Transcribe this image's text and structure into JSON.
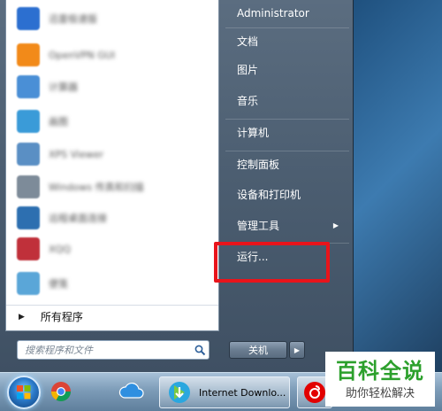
{
  "start_menu": {
    "all_programs_label": "所有程序",
    "search_placeholder": "搜索程序和文件",
    "right_items": [
      {
        "label": "Administrator"
      },
      {
        "label": "文档"
      },
      {
        "label": "图片"
      },
      {
        "label": "音乐"
      },
      {
        "label": "计算机"
      },
      {
        "label": "控制面板"
      },
      {
        "label": "设备和打印机"
      },
      {
        "label": "管理工具"
      },
      {
        "label": "运行..."
      }
    ],
    "shutdown_label": "关机",
    "highlight_color": "#e8141b",
    "pinned_programs": [
      {
        "label": "迅雷极速版",
        "icon": "app-icon",
        "color": "#2c6fd0"
      },
      {
        "label": "OpenVPN GUI",
        "icon": "openvpn-icon",
        "color": "#f28a19"
      },
      {
        "label": "计算器",
        "icon": "calculator-icon",
        "color": "#4a8fd6"
      },
      {
        "label": "画图",
        "icon": "paint-icon",
        "color": "#3a9bd8"
      },
      {
        "label": "XPS Viewer",
        "icon": "xps-icon",
        "color": "#5a8fc4"
      },
      {
        "label": "Windows 传真和扫描",
        "icon": "fax-icon",
        "color": "#7d8b99"
      },
      {
        "label": "远程桌面连接",
        "icon": "remote-desktop-icon",
        "color": "#2d6fb0"
      },
      {
        "label": "XQQ",
        "icon": "app-icon",
        "color": "#c0303a"
      },
      {
        "label": "便笺",
        "icon": "sticky-icon",
        "color": "#5aa6d8"
      }
    ]
  },
  "taskbar": {
    "items": [
      {
        "label": "Internet Downlo..."
      }
    ],
    "icons": [
      "start-orb-icon",
      "chrome-icon",
      "cloud-icon",
      "idm-icon",
      "netease-music-icon"
    ]
  },
  "watermark": {
    "title": "百科全说",
    "subtitle": "助你轻松解决"
  }
}
